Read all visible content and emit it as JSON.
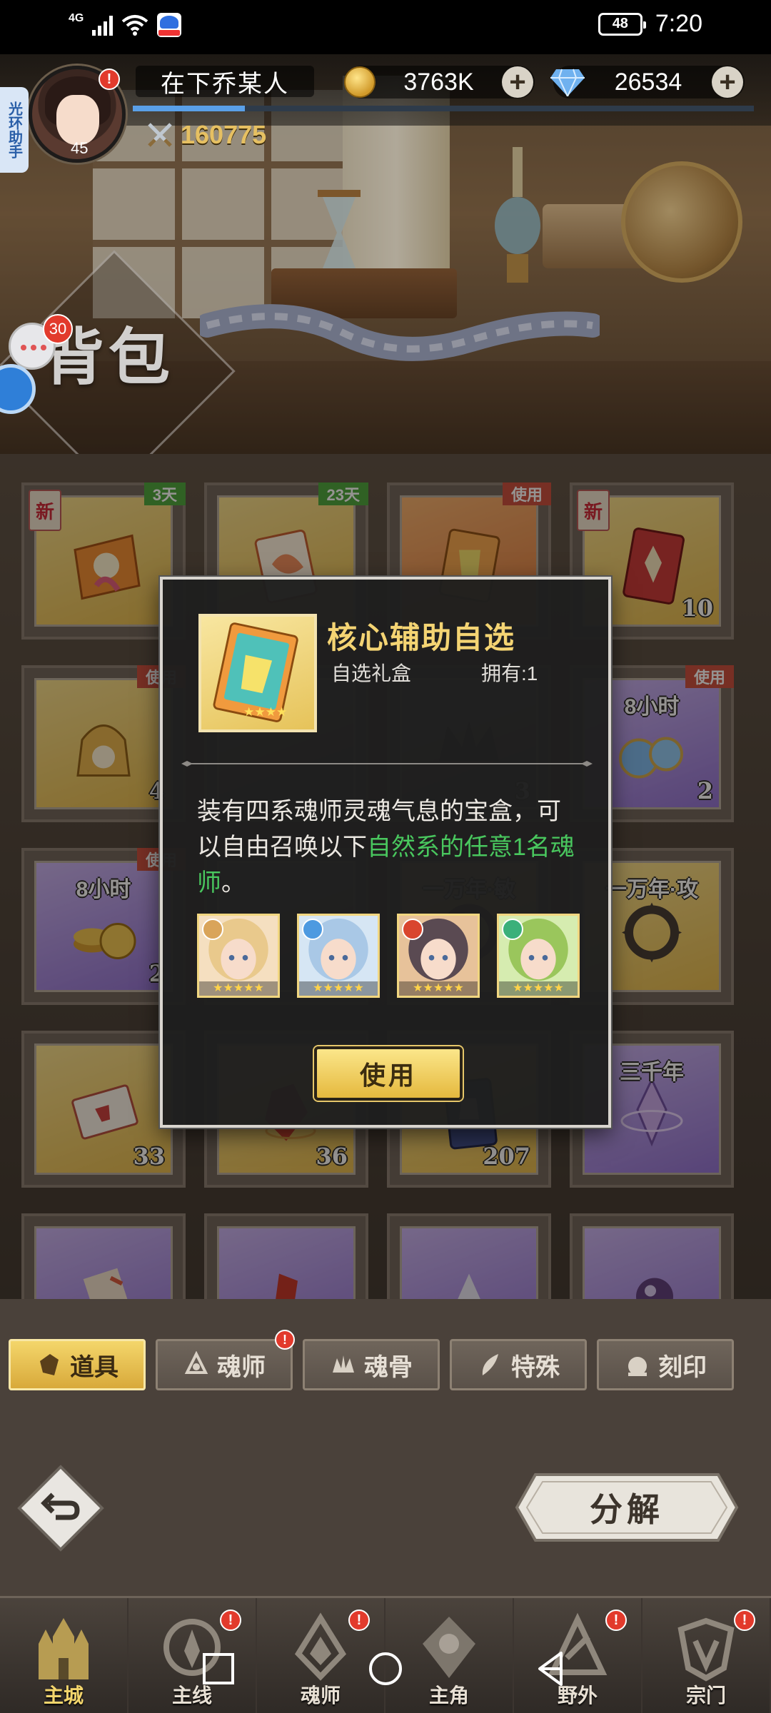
{
  "status_bar": {
    "network": "4G",
    "battery": "48",
    "time": "7:20"
  },
  "profile": {
    "name": "在下乔某人",
    "level": "45",
    "power": "160775",
    "alert": "!",
    "exp_fraction": 0.18
  },
  "resources": {
    "coins": "3763K",
    "gems": "26534",
    "plus": "+"
  },
  "side_tab": {
    "label": "光环助手"
  },
  "page": {
    "title": "背包",
    "chat_count": "30"
  },
  "inventory": {
    "items": [
      {
        "tag": "3天",
        "tag_color": "green",
        "new": true,
        "new_label": "新",
        "quality": "gold",
        "count": "",
        "time": "",
        "icon": "gift-box-icon"
      },
      {
        "tag": "23天",
        "tag_color": "green",
        "new": false,
        "quality": "gold",
        "count": "",
        "time": "",
        "icon": "card-pack-icon"
      },
      {
        "tag": "使用",
        "tag_color": "red",
        "new": false,
        "quality": "orange",
        "count": "",
        "time": "",
        "icon": "selection-card-icon"
      },
      {
        "tag": "",
        "tag_color": "",
        "new": true,
        "new_label": "新",
        "quality": "gold",
        "count": "10",
        "time": "",
        "icon": "red-card-icon"
      },
      {
        "tag": "使用",
        "tag_color": "red",
        "new": false,
        "quality": "gold",
        "count": "4",
        "time": "",
        "icon": "gold-bag-icon"
      },
      {
        "tag": "",
        "tag_color": "",
        "new": false,
        "quality": "gray",
        "count": "",
        "time": "",
        "icon": "blank-icon"
      },
      {
        "tag": "",
        "tag_color": "",
        "new": false,
        "quality": "gray",
        "count": "3",
        "time": "",
        "icon": "dark-crown-icon"
      },
      {
        "tag": "使用",
        "tag_color": "red",
        "new": false,
        "quality": "purple",
        "count": "2",
        "time": "8小时",
        "icon": "potion-icon"
      },
      {
        "tag": "使用",
        "tag_color": "red",
        "new": false,
        "quality": "purple",
        "count": "2",
        "time": "8小时",
        "icon": "gold-coins-icon"
      },
      {
        "tag": "",
        "tag_color": "",
        "new": false,
        "quality": "gray",
        "count": "",
        "time": "",
        "icon": "blank-icon"
      },
      {
        "tag": "",
        "tag_color": "",
        "new": false,
        "quality": "gold",
        "count": "",
        "time": "一万年·敏",
        "icon": "ring-icon"
      },
      {
        "tag": "",
        "tag_color": "",
        "new": false,
        "quality": "gold",
        "count": "",
        "time": "一万年·攻",
        "icon": "spiked-ring-icon"
      },
      {
        "tag": "",
        "tag_color": "",
        "new": false,
        "quality": "gold",
        "count": "33",
        "time": "",
        "icon": "ticket-icon"
      },
      {
        "tag": "",
        "tag_color": "",
        "new": false,
        "quality": "gold",
        "count": "36",
        "time": "",
        "icon": "red-gem-icon"
      },
      {
        "tag": "",
        "tag_color": "",
        "new": false,
        "quality": "gold",
        "count": "207",
        "time": "",
        "icon": "blue-card-icon"
      },
      {
        "tag": "",
        "tag_color": "",
        "new": false,
        "quality": "purple",
        "count": "",
        "time": "三千年",
        "icon": "crystal-icon"
      },
      {
        "tag": "",
        "tag_color": "",
        "new": false,
        "quality": "purple",
        "count": "",
        "time": "",
        "icon": "scroll-icon"
      },
      {
        "tag": "",
        "tag_color": "",
        "new": false,
        "quality": "purple",
        "count": "",
        "time": "",
        "icon": "red-crystal-icon"
      },
      {
        "tag": "",
        "tag_color": "",
        "new": false,
        "quality": "purple",
        "count": "",
        "time": "",
        "icon": "shard-icon"
      },
      {
        "tag": "",
        "tag_color": "",
        "new": false,
        "quality": "purple",
        "count": "",
        "time": "",
        "icon": "orb-icon"
      }
    ]
  },
  "modal": {
    "title": "核心辅助自选",
    "type": "自选礼盒",
    "owned": "拥有:1",
    "desc_before": "装有四系魂师灵魂气息的宝盒，可以自由召唤以下",
    "desc_highlight": "自然系的任意1名魂师",
    "desc_after": "。",
    "heroes": [
      {
        "element": "light",
        "stars": "★★★★★"
      },
      {
        "element": "water",
        "stars": "★★★★★"
      },
      {
        "element": "fire",
        "stars": "★★★★★"
      },
      {
        "element": "wind",
        "stars": "★★★★★"
      }
    ],
    "use_button": "使用"
  },
  "tabs": [
    {
      "label": "道具",
      "active": true,
      "badge": false
    },
    {
      "label": "魂师",
      "active": false,
      "badge": true
    },
    {
      "label": "魂骨",
      "active": false,
      "badge": false
    },
    {
      "label": "特殊",
      "active": false,
      "badge": false
    },
    {
      "label": "刻印",
      "active": false,
      "badge": false
    }
  ],
  "actions": {
    "decompose": "分解"
  },
  "bottom_nav": [
    {
      "label": "主城",
      "active": true,
      "badge": false
    },
    {
      "label": "主线",
      "active": false,
      "badge": true
    },
    {
      "label": "魂师",
      "active": false,
      "badge": true
    },
    {
      "label": "主角",
      "active": false,
      "badge": false
    },
    {
      "label": "野外",
      "active": false,
      "badge": true
    },
    {
      "label": "宗门",
      "active": false,
      "badge": true
    }
  ],
  "colors": {
    "accent_gold": "#f4d473",
    "highlight_green": "#49c75e",
    "badge_red": "#e23a2c"
  }
}
